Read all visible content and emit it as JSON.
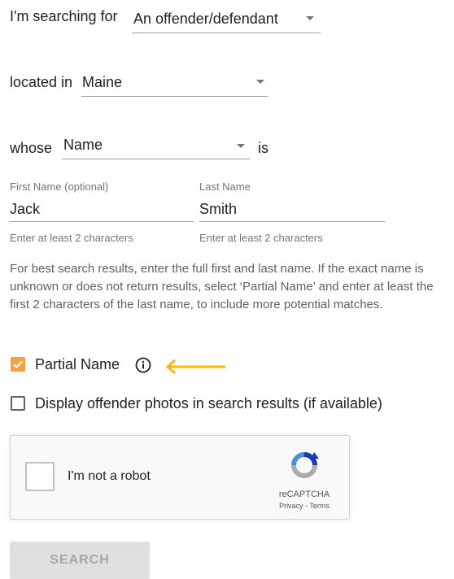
{
  "search_for": {
    "label": "I'm searching for",
    "value": "An offender/defendant"
  },
  "location": {
    "label": "located in",
    "value": "Maine"
  },
  "criteria": {
    "label": "whose",
    "value": "Name",
    "suffix": "is"
  },
  "first_name": {
    "label": "First Name (optional)",
    "value": "Jack",
    "hint": "Enter at least 2 characters"
  },
  "last_name": {
    "label": "Last Name",
    "value": "Smith",
    "hint": "Enter at least 2 characters"
  },
  "help_text": "For best search results, enter the full first and last name. If the exact name is unknown or does not return results, select ‘Partial Name’ and enter at least the first 2 characters of the last name, to include more potential matches.",
  "partial_name": {
    "label": "Partial Name",
    "checked": true
  },
  "display_photos": {
    "label": "Display offender photos in search results (if available)",
    "checked": false
  },
  "recaptcha": {
    "label": "I'm not a robot",
    "brand": "reCAPTCHA",
    "privacy": "Privacy",
    "separator": " - ",
    "terms": "Terms"
  },
  "search_button": {
    "label": "SEARCH"
  },
  "colors": {
    "checkbox_checked": "#f5a042",
    "arrow": "#f7b800",
    "button_bg": "#e0e0e0"
  }
}
